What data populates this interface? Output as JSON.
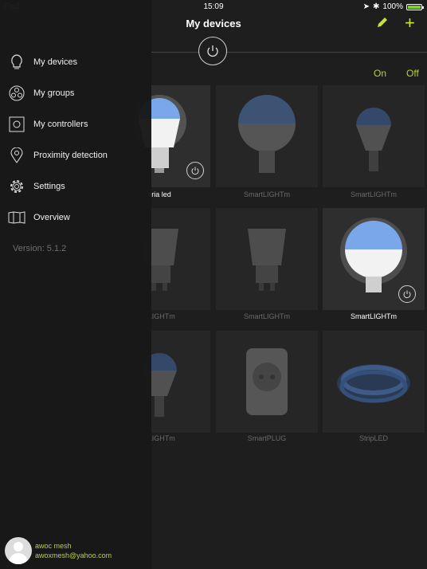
{
  "status_bar": {
    "device": "iPad",
    "time": "15:09",
    "battery": "100%",
    "battery_level": 1.0
  },
  "header": {
    "title": "My devices",
    "edit_icon": "pencil-icon",
    "add_icon": "plus-icon"
  },
  "toggles": {
    "on": "On",
    "off": "Off"
  },
  "devices": [
    {
      "label": "eria led",
      "type": "bulb-a60",
      "active": true
    },
    {
      "label": "SmartLIGHTm",
      "type": "bulb-globe",
      "active": false
    },
    {
      "label": "SmartLIGHTm",
      "type": "bulb-candle",
      "active": false
    },
    {
      "label": "rtLIGHTm",
      "type": "spot-gu10",
      "active": false
    },
    {
      "label": "SmartLIGHTm",
      "type": "spot-gu10",
      "active": false
    },
    {
      "label": "SmartLIGHTm",
      "type": "bulb-globe",
      "active": true
    },
    {
      "label": "rtLIGHTm",
      "type": "bulb-candle",
      "active": false
    },
    {
      "label": "SmartPLUG",
      "type": "plug",
      "active": false
    },
    {
      "label": "StripLED",
      "type": "strip",
      "active": false
    }
  ],
  "sidebar": {
    "items": [
      {
        "label": "My devices",
        "icon": "bulb-icon"
      },
      {
        "label": "My groups",
        "icon": "groups-icon"
      },
      {
        "label": "My controllers",
        "icon": "controller-icon"
      },
      {
        "label": "Proximity detection",
        "icon": "location-pin-icon"
      },
      {
        "label": "Settings",
        "icon": "gear-icon"
      },
      {
        "label": "Overview",
        "icon": "map-icon"
      }
    ],
    "version": "Version: 5.1.2"
  },
  "user": {
    "name": "awoc mesh",
    "email": "awoxmesh@yahoo.com"
  },
  "colors": {
    "accent": "#b5d334",
    "bulb_blue": "#6f9be0",
    "background": "#1e1e1e"
  }
}
